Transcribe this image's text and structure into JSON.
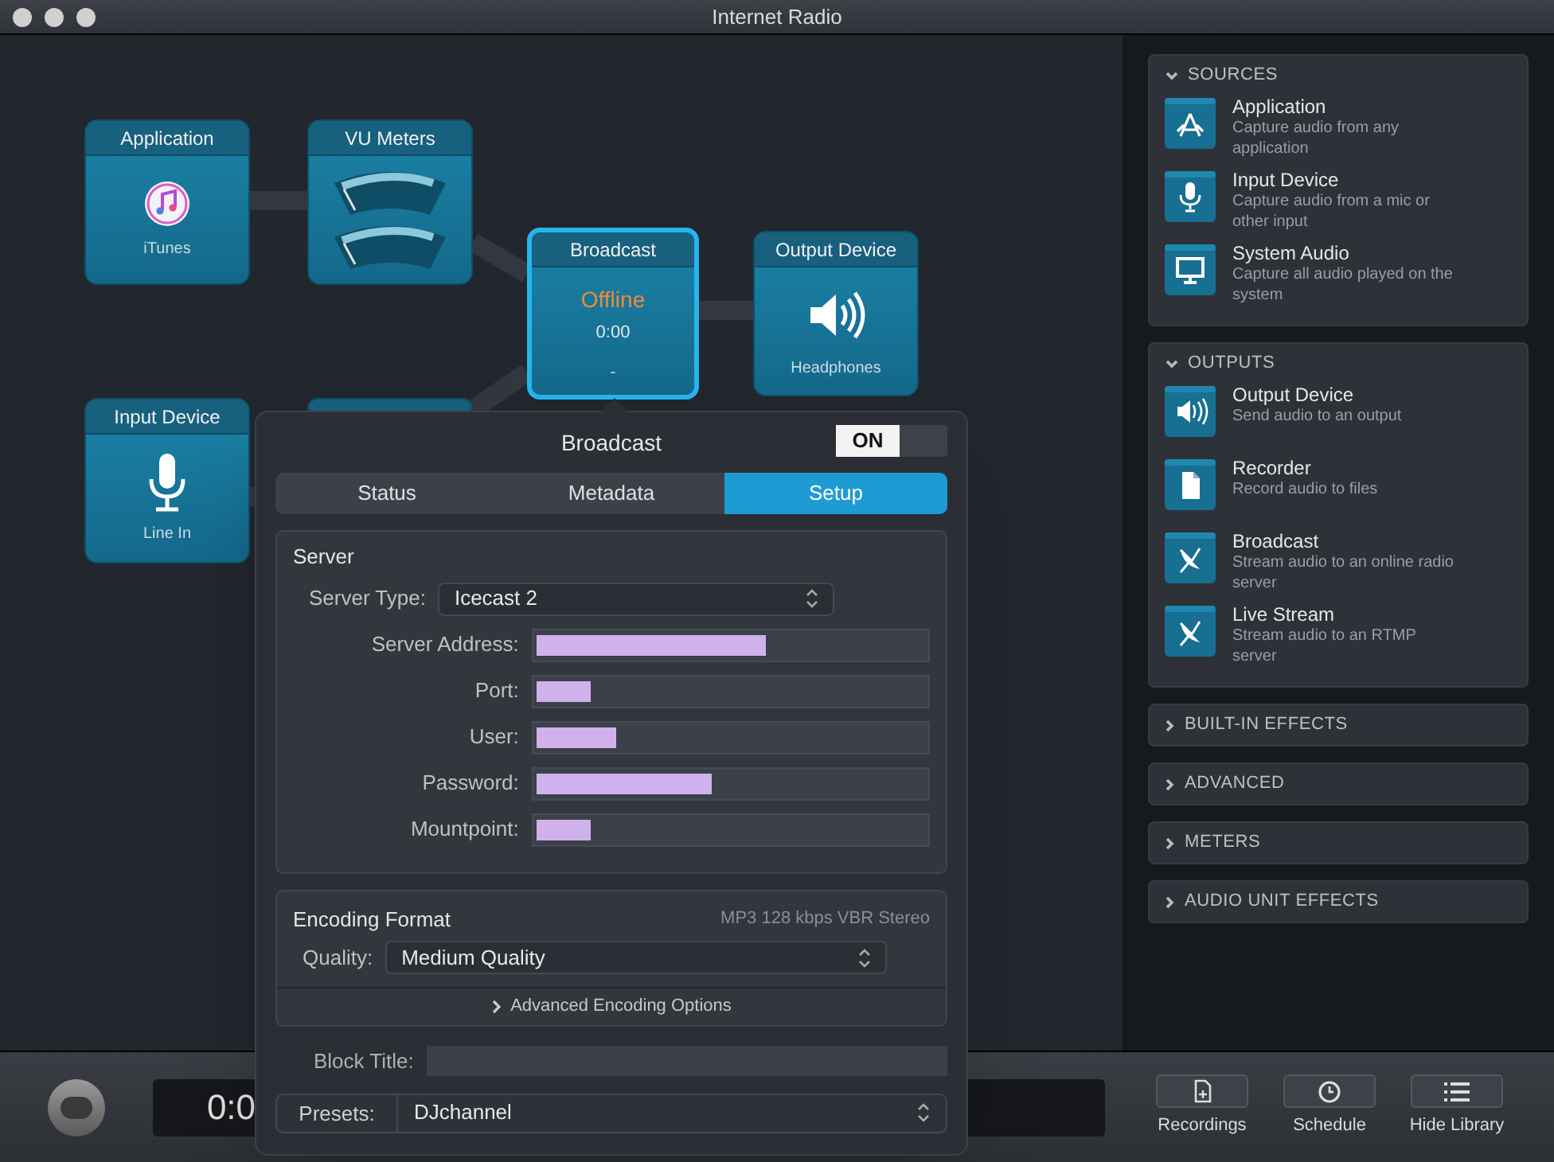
{
  "window": {
    "title": "Internet Radio"
  },
  "canvas": {
    "nodes": [
      {
        "kind": "application",
        "title": "Application",
        "subtitle": "iTunes",
        "selected": false
      },
      {
        "kind": "meters",
        "title": "VU Meters",
        "selected": false
      },
      {
        "kind": "broadcast",
        "title": "Broadcast",
        "status": "Offline",
        "time": "0:00",
        "detail": "-",
        "selected": true
      },
      {
        "kind": "output",
        "title": "Output Device",
        "subtitle": "Headphones",
        "selected": false
      },
      {
        "kind": "input",
        "title": "Input Device",
        "subtitle": "Line In",
        "selected": false
      },
      {
        "kind": "hidden",
        "selected": false
      }
    ]
  },
  "popover": {
    "title": "Broadcast",
    "toggle": {
      "label": "ON",
      "on": true
    },
    "tabs": [
      {
        "label": "Status",
        "selected": false
      },
      {
        "label": "Metadata",
        "selected": false
      },
      {
        "label": "Setup",
        "selected": true
      }
    ],
    "server": {
      "heading": "Server",
      "server_type": {
        "label": "Server Type:",
        "value": "Icecast 2"
      },
      "fields": [
        {
          "label": "Server Address:",
          "redacted": true
        },
        {
          "label": "Port:",
          "redacted": true
        },
        {
          "label": "User:",
          "redacted": true
        },
        {
          "label": "Password:",
          "redacted": true
        },
        {
          "label": "Mountpoint:",
          "redacted": true
        }
      ]
    },
    "encoding": {
      "heading": "Encoding Format",
      "summary": "MP3 128 kbps VBR Stereo",
      "quality": {
        "label": "Quality:",
        "value": "Medium Quality"
      },
      "advanced": "Advanced Encoding Options"
    },
    "block_title": {
      "label": "Block Title:"
    },
    "presets": {
      "label": "Presets:",
      "value": "DJchannel"
    }
  },
  "sidebar": {
    "sections": [
      {
        "title": "SOURCES",
        "expanded": true,
        "items": [
          {
            "kind": "app",
            "title": "Application",
            "description": "Capture audio from any application"
          },
          {
            "kind": "mic",
            "title": "Input Device",
            "description": "Capture audio from a mic or other input"
          },
          {
            "kind": "monitor",
            "title": "System Audio",
            "description": "Capture all audio played on the system"
          }
        ]
      },
      {
        "title": "OUTPUTS",
        "expanded": true,
        "items": [
          {
            "kind": "speaker",
            "title": "Output Device",
            "description": "Send audio to an output"
          },
          {
            "kind": "file",
            "title": "Recorder",
            "description": "Record audio to files"
          },
          {
            "kind": "dish",
            "title": "Broadcast",
            "description": "Stream audio to an online radio server"
          },
          {
            "kind": "dish",
            "title": "Live Stream",
            "description": "Stream audio to an RTMP server"
          }
        ]
      },
      {
        "title": "BUILT-IN EFFECTS",
        "expanded": false
      },
      {
        "title": "ADVANCED",
        "expanded": false
      },
      {
        "title": "METERS",
        "expanded": false
      },
      {
        "title": "AUDIO UNIT EFFECTS",
        "expanded": false
      }
    ]
  },
  "bottom_bar": {
    "time": "0:0",
    "buttons": [
      {
        "kind": "recordings",
        "label": "Recordings"
      },
      {
        "kind": "clock",
        "label": "Schedule"
      },
      {
        "kind": "list",
        "label": "Hide Library"
      }
    ]
  }
}
